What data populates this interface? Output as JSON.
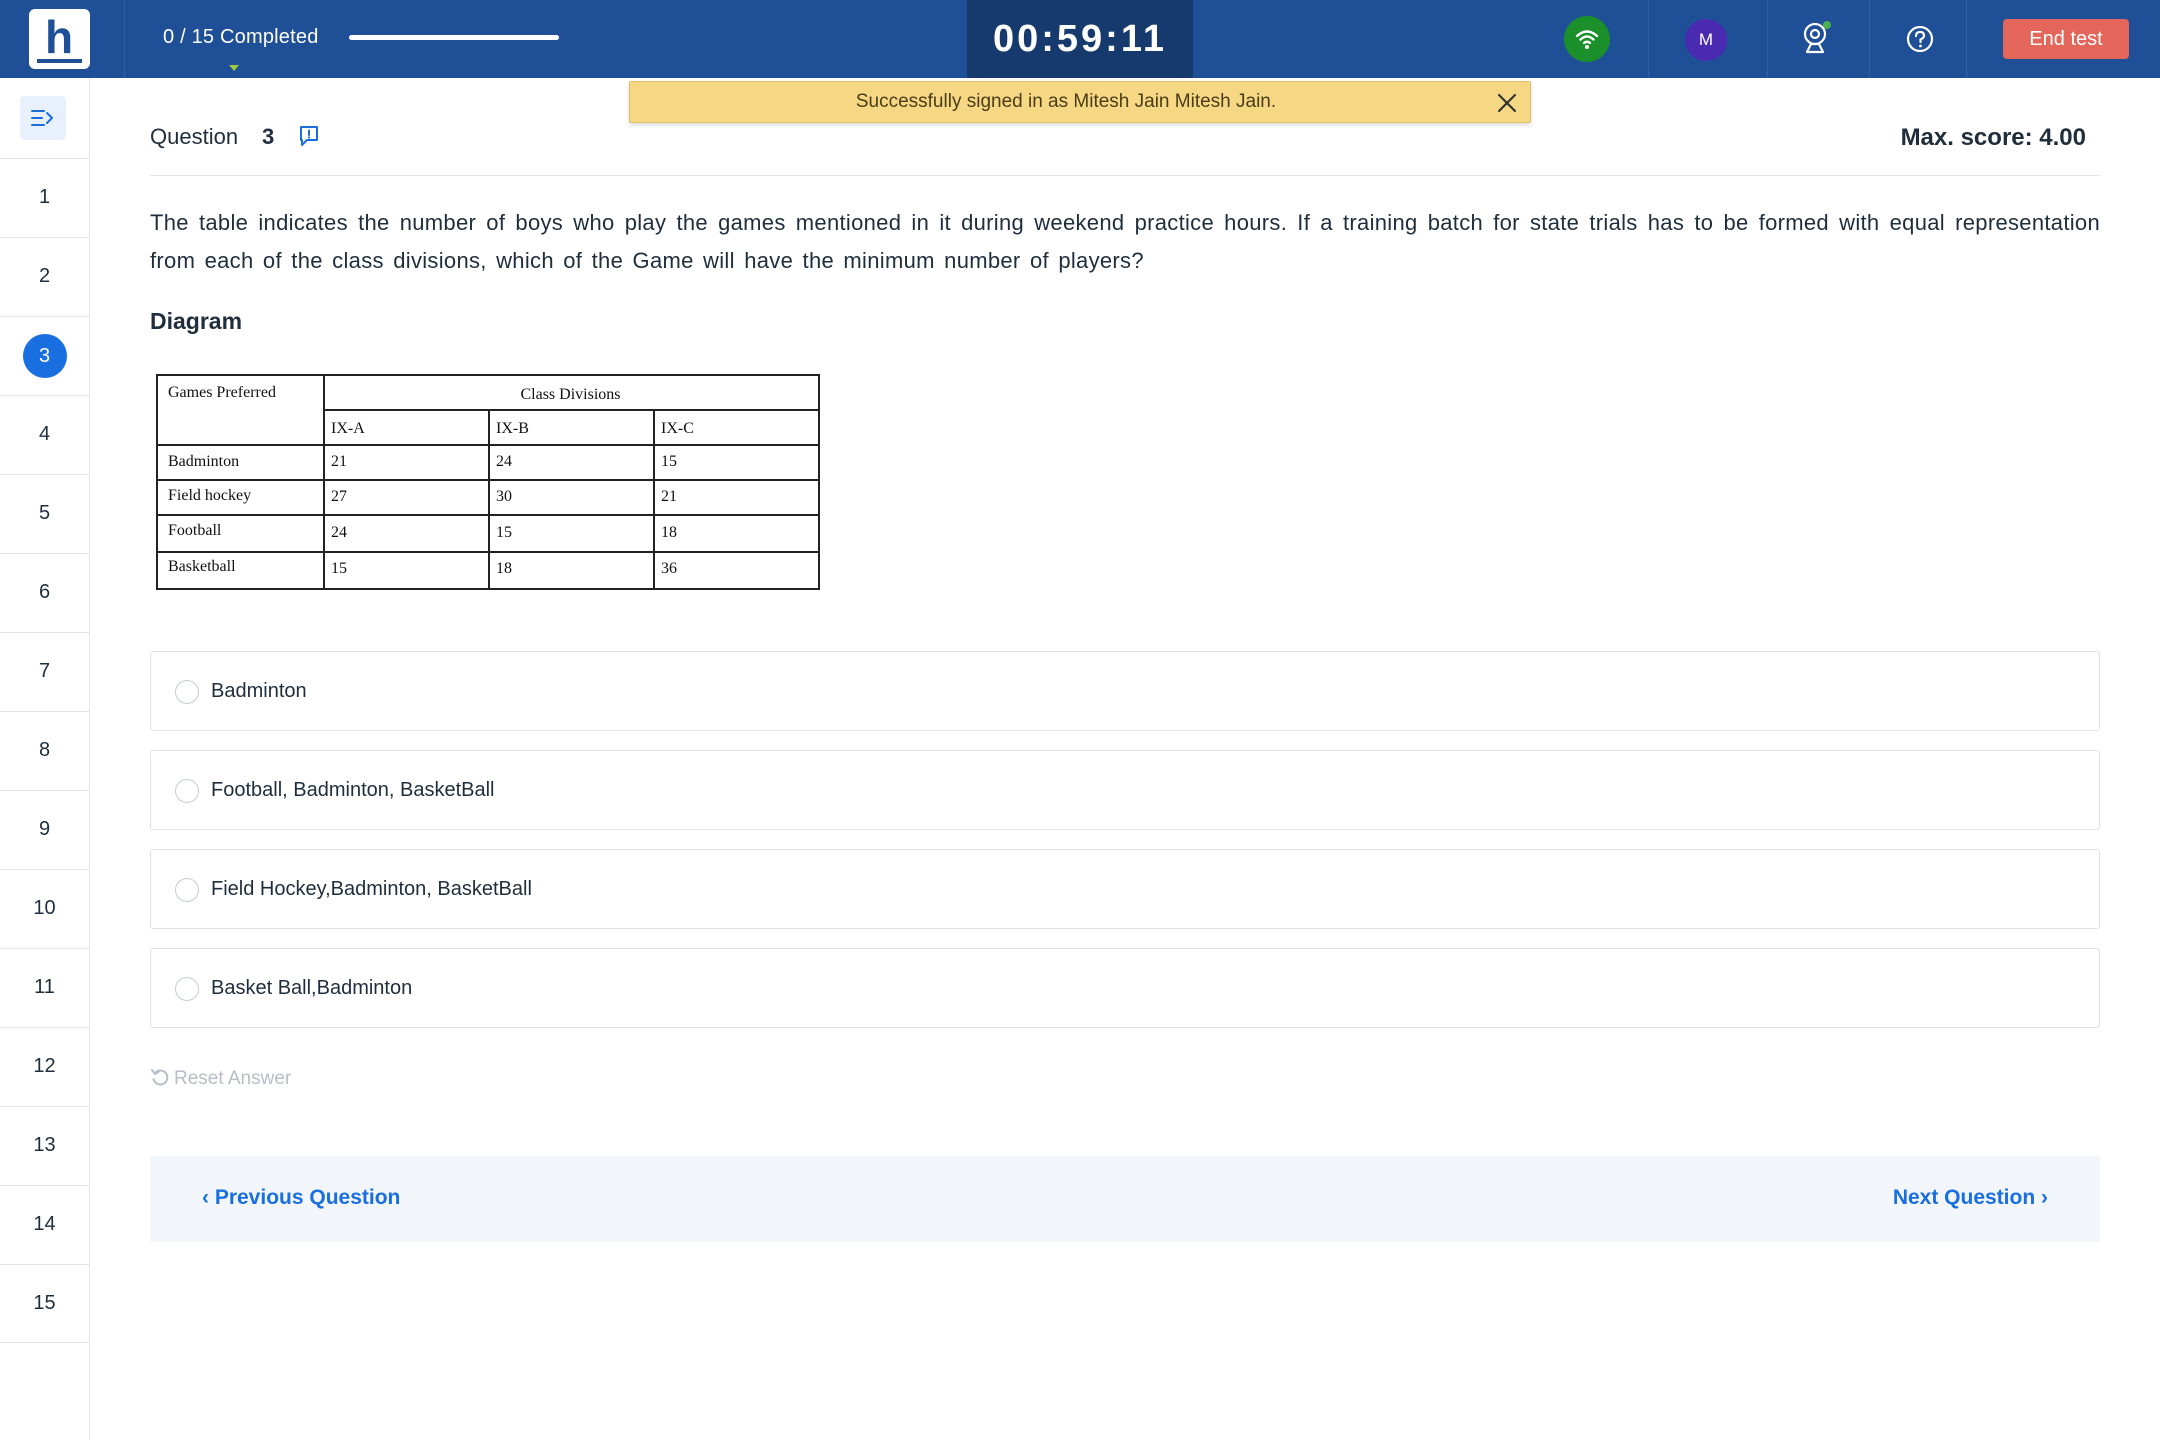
{
  "header": {
    "logo_letter": "h",
    "progress_text": "0 / 15 Completed",
    "progress_fraction": 0,
    "timer": "00:59:11",
    "network_icon": "wifi-icon",
    "avatar_initial": "M",
    "camera_icon": "webcam-icon",
    "help_icon": "help-icon",
    "end_test_label": "End test",
    "colors": {
      "bar": "#1e4f97",
      "timer": "#173a6e",
      "end_button": "#e4665a",
      "network": "#1a8f2a",
      "avatar": "#4a2ab0"
    }
  },
  "toast": {
    "message": "Successfully signed in as Mitesh Jain Mitesh Jain.",
    "close_icon": "close-icon",
    "color": "#f6d884"
  },
  "sidebar": {
    "toggle_icon": "collapse-sidebar-icon",
    "questions": [
      "1",
      "2",
      "3",
      "4",
      "5",
      "6",
      "7",
      "8",
      "9",
      "10",
      "11",
      "12",
      "13",
      "14",
      "15"
    ],
    "active_question": "3",
    "active_color": "#1a6fe0"
  },
  "question": {
    "title": "Question",
    "number": "3",
    "flag_icon": "report-flag-icon",
    "max_score": "Max. score: 4.00",
    "text": "The table indicates the number of boys who play the games mentioned in it during weekend practice hours. If a training batch for state trials has to be formed with equal representation from each of the class divisions, which of the Game will have the minimum number of players?",
    "diagram_label": "Diagram"
  },
  "diagram_table": {
    "corner_header": "Games Preferred",
    "group_header": "Class Divisions",
    "columns": [
      "IX-A",
      "IX-B",
      "IX-C"
    ],
    "rows": [
      {
        "label": "Badminton",
        "values": [
          "21",
          "24",
          "15"
        ]
      },
      {
        "label": "Field hockey",
        "values": [
          "27",
          "30",
          "21"
        ]
      },
      {
        "label": "Football",
        "values": [
          "24",
          "15",
          "18"
        ]
      },
      {
        "label": "Basketball",
        "values": [
          "15",
          "18",
          "36"
        ]
      }
    ]
  },
  "options": [
    {
      "label": "Badminton"
    },
    {
      "label": "Football, Badminton, BasketBall"
    },
    {
      "label": "Field Hockey,Badminton, BasketBall"
    },
    {
      "label": "Basket Ball,Badminton"
    }
  ],
  "reset_label": "Reset Answer",
  "reset_icon": "undo-icon",
  "navigation": {
    "previous_label": "‹ Previous Question",
    "next_label": "Next Question ›",
    "link_color": "#1a6fe0"
  }
}
